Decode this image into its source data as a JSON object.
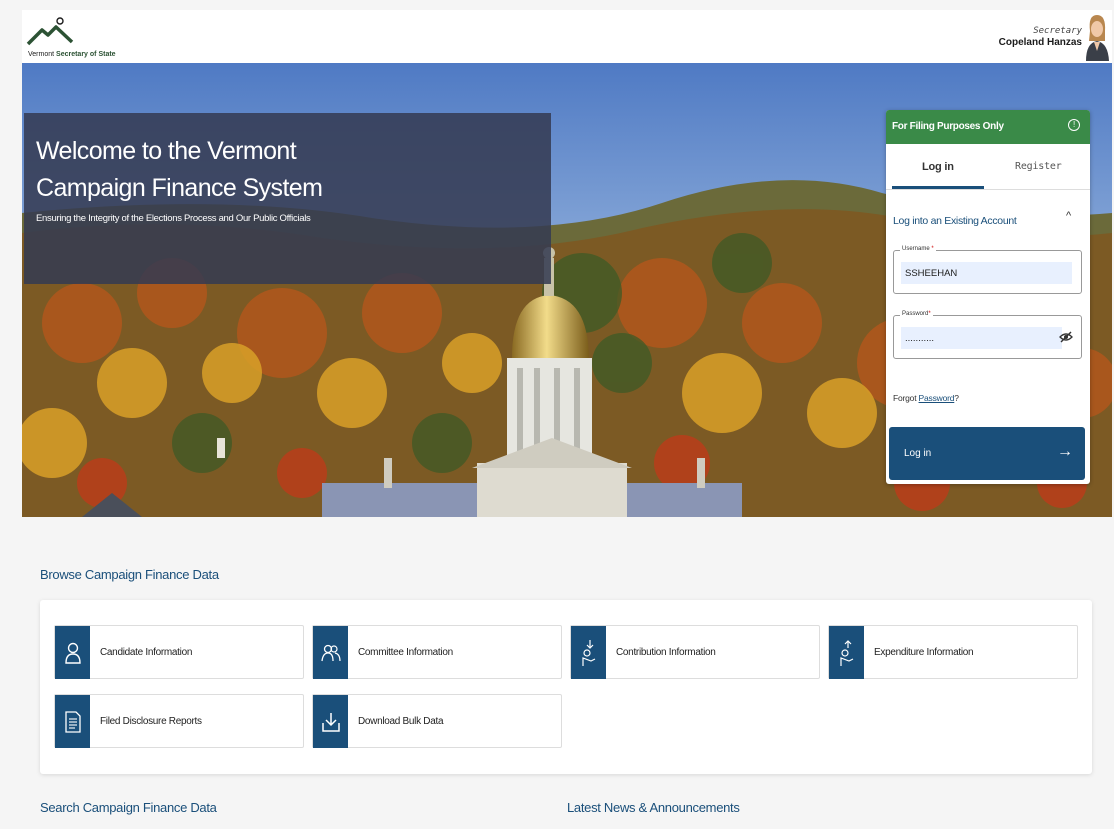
{
  "header": {
    "logo_prefix": "Vermont",
    "logo_text": "Secretary of State",
    "secretary_title": "Secretary",
    "secretary_name": "Copeland Hanzas"
  },
  "hero": {
    "title_line1": "Welcome to the Vermont",
    "title_line2": "Campaign Finance System",
    "subtitle": "Ensuring the Integrity of the Elections Process and Our Public Officials"
  },
  "login": {
    "banner": "For Filing Purposes Only",
    "info_icon": "info-icon",
    "tab_login": "Log in",
    "tab_register": "Register",
    "section_title": "Log into an Existing Account",
    "username_label": "Username",
    "username_value": "SSHEEHAN",
    "password_label": "Password",
    "password_value": "...........",
    "forgot_prefix": "Forgot",
    "forgot_link": "Password",
    "forgot_suffix": "?",
    "button_label": "Log in",
    "required_mark": "*"
  },
  "browse": {
    "title": "Browse Campaign Finance Data",
    "tiles": [
      {
        "label": "Candidate Information",
        "icon": "person-icon"
      },
      {
        "label": "Committee Information",
        "icon": "group-icon"
      },
      {
        "label": "Contribution Information",
        "icon": "hand-coin-in-icon"
      },
      {
        "label": "Expenditure Information",
        "icon": "hand-coin-out-icon"
      },
      {
        "label": "Filed Disclosure Reports",
        "icon": "document-icon"
      },
      {
        "label": "Download Bulk Data",
        "icon": "download-icon"
      }
    ]
  },
  "sections": {
    "search_title": "Search Campaign Finance Data",
    "news_title": "Latest News & Announcements"
  },
  "colors": {
    "primary": "#1a4f7a",
    "banner_green": "#3a8a48",
    "overlay": "#343a52"
  }
}
